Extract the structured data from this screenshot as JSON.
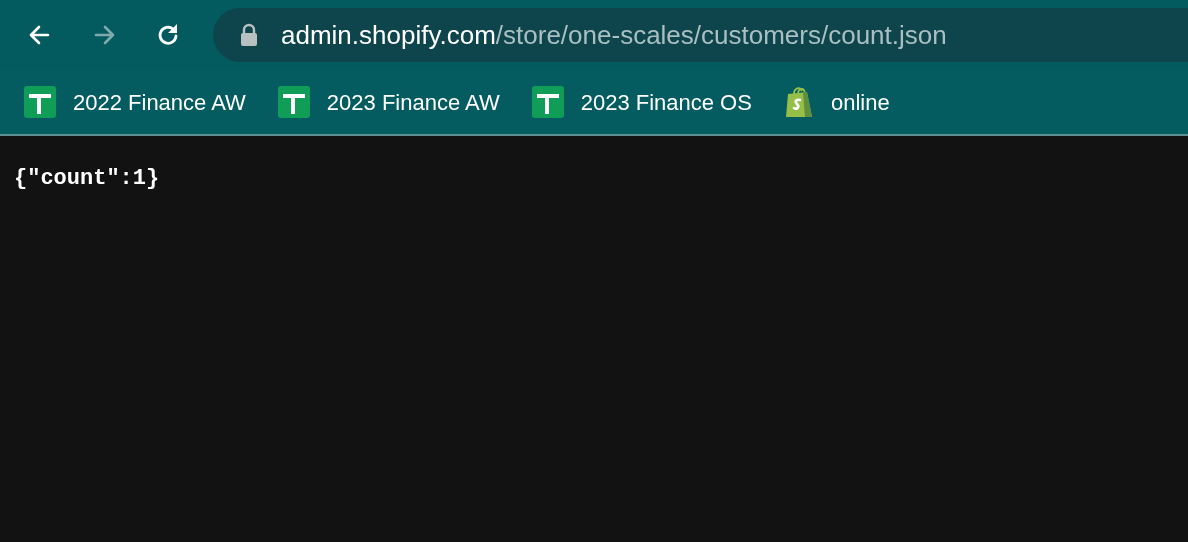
{
  "toolbar": {
    "buttons": [
      {
        "kind": "back",
        "disabled": false
      },
      {
        "kind": "forward",
        "disabled": true
      },
      {
        "kind": "reload",
        "disabled": false
      }
    ]
  },
  "address_bar": {
    "secure": true,
    "host": "admin.shopify.com",
    "path": "/store/one-scales/customers/count.json"
  },
  "bookmarks": [
    {
      "kind": "sheet",
      "label": "2022 Finance AW"
    },
    {
      "kind": "sheet",
      "label": "2023 Finance AW"
    },
    {
      "kind": "sheet",
      "label": "2023 Finance OS"
    },
    {
      "kind": "shop",
      "label": "online"
    }
  ],
  "content": {
    "text": "{\"count\":1}"
  }
}
